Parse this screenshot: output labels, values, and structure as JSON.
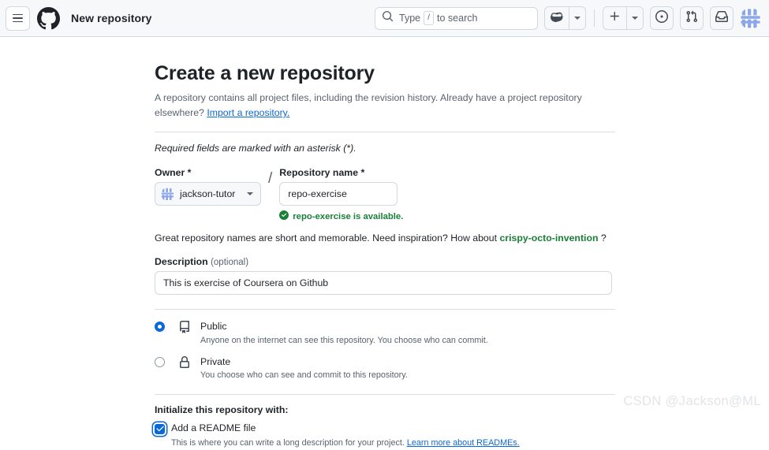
{
  "header": {
    "menu_icon": "hamburger-icon",
    "logo_icon": "github-logo-icon",
    "title": "New repository",
    "search": {
      "icon": "search-icon",
      "prefix": "Type",
      "key": "/",
      "suffix": "to search"
    },
    "copilot_icon": "copilot-icon",
    "copilot_caret_icon": "chevron-down-icon",
    "plus_icon": "plus-icon",
    "plus_caret_icon": "chevron-down-icon",
    "issues_icon": "issue-opened-icon",
    "pull_requests_icon": "git-pull-request-icon",
    "inbox_icon": "inbox-icon",
    "avatar_icon": "user-avatar"
  },
  "page": {
    "heading": "Create a new repository",
    "lede_part1": "A repository contains all project files, including the revision history. Already have a project repository elsewhere? ",
    "lede_link": "Import a repository.",
    "required_note": "Required fields are marked with an asterisk (*)."
  },
  "owner": {
    "label": "Owner *",
    "value": "jackson-tutor",
    "caret_icon": "chevron-down-icon",
    "avatar_icon": "owner-avatar"
  },
  "separator": "/",
  "repo_name": {
    "label": "Repository name *",
    "value": "repo-exercise",
    "placeholder": "",
    "availability_icon": "check-circle-fill-icon",
    "availability_message": "repo-exercise is available."
  },
  "suggestion": {
    "text_before": "Great repository names are short and memorable. Need inspiration? How about ",
    "name": "crispy-octo-invention",
    "text_after": " ?"
  },
  "description": {
    "label": "Description",
    "optional": "(optional)",
    "value": "This is exercise of Coursera on Github",
    "placeholder": ""
  },
  "visibility": {
    "options": [
      {
        "id": "public",
        "title": "Public",
        "subtitle": "Anyone on the internet can see this repository. You choose who can commit.",
        "icon": "repo-icon",
        "selected": true
      },
      {
        "id": "private",
        "title": "Private",
        "subtitle": "You choose who can see and commit to this repository.",
        "icon": "lock-icon",
        "selected": false
      }
    ]
  },
  "initialize": {
    "title": "Initialize this repository with:",
    "readme": {
      "label": "Add a README file",
      "checked": true,
      "sub_text": "This is where you can write a long description for your project. ",
      "sub_link": "Learn more about READMEs."
    }
  },
  "watermark": "CSDN @Jackson@ML",
  "colors": {
    "accent": "#0969da",
    "success": "#1a7f37",
    "header_bg": "#f6f8fa",
    "border": "#d1d9e0",
    "muted_text": "#59636e"
  }
}
